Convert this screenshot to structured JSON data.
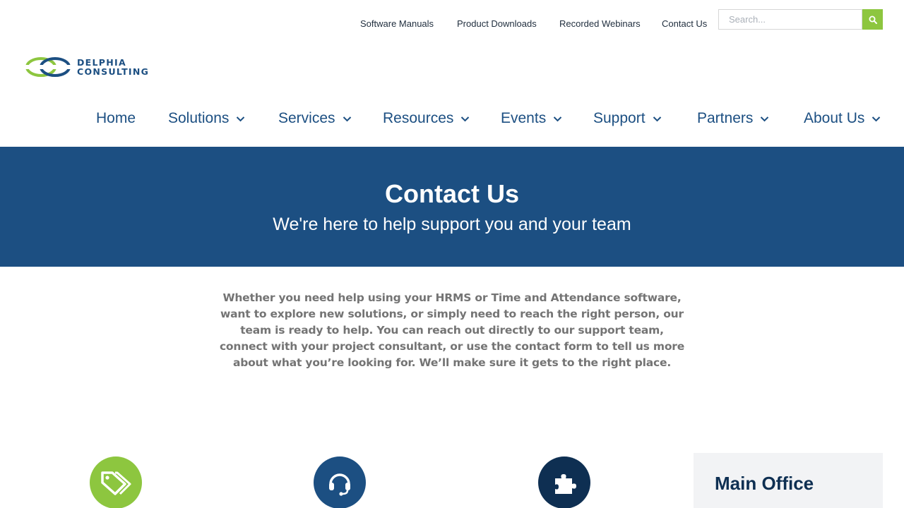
{
  "utility_links": [
    "Software Manuals",
    "Product Downloads",
    "Recorded Webinars",
    "Contact Us"
  ],
  "search": {
    "placeholder": "Search..."
  },
  "logo": {
    "line1": "DELPHIA",
    "line2": "CONSULTING"
  },
  "nav": [
    "Home",
    "Solutions",
    "Services",
    "Resources",
    "Events",
    "Support",
    "Partners",
    "About Us"
  ],
  "hero": {
    "title": "Contact Us",
    "subtitle": "We're here to help support you and your team"
  },
  "intro": "Whether you need help using your HRMS or Time and Attendance software, want to explore new solutions, or simply need to reach the right person, our team is ready to help. You can reach out directly to our support team, connect with your project consultant, or use the contact form to tell us more about what you’re looking for. We’ll make sure it gets to the right place.",
  "features": [
    {
      "icon": "tags-icon",
      "color": "#8dc63f"
    },
    {
      "icon": "headset-icon",
      "color": "#1c4f82"
    },
    {
      "icon": "puzzle-icon",
      "color": "#0e2f52"
    }
  ],
  "office": {
    "title": "Main Office"
  },
  "colors": {
    "brand_blue": "#1c4f82",
    "accent_green": "#8dc63f",
    "navy": "#0e2f52"
  }
}
